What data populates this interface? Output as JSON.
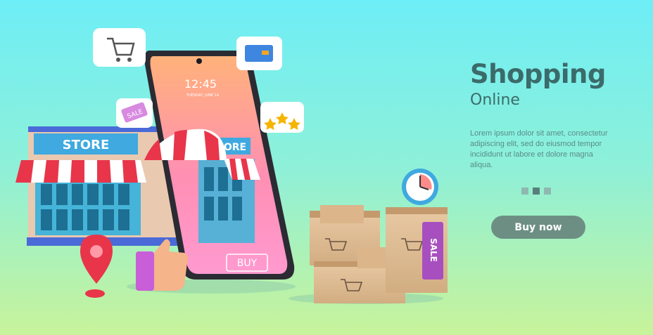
{
  "hero": {
    "title": "Shopping",
    "subtitle": "Online",
    "body": "Lorem ipsum dolor sit amet, consectetur adipiscing elit, sed do eiusmod tempor incididunt ut labore et dolore magna aliqua.",
    "cta_label": "Buy now",
    "pager": {
      "count": 3,
      "active": 2
    }
  },
  "illustration": {
    "store_sign": "STORE",
    "store_sign_side": "ORE",
    "phone_time": "12:45",
    "phone_date": "TUESDAY, JUNE 14",
    "phone_buy": "BUY",
    "sale_tag": "SALE",
    "sale_vertical": "SALE",
    "rating_stars": 3
  },
  "colors": {
    "accent": "#6d8f83",
    "heading": "#3b6b6a",
    "awning_red": "#e8354a"
  }
}
